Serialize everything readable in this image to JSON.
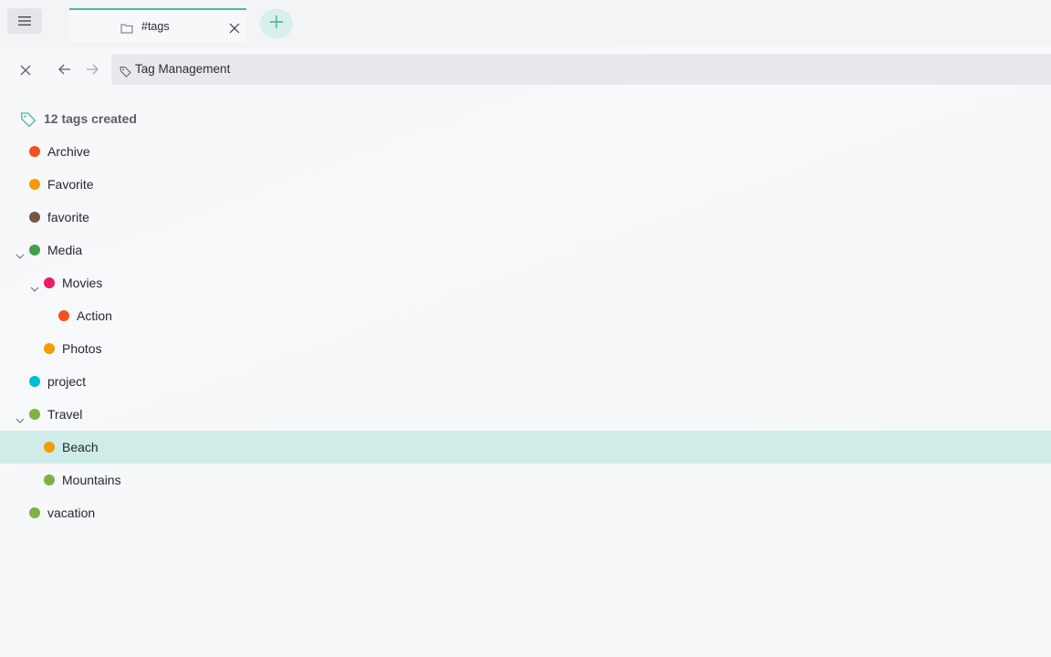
{
  "tabbar": {
    "menu_icon": "hamburger-icon",
    "tab": {
      "title": "#tags",
      "icon": "folder-icon",
      "close_icon": "close-icon",
      "accent": "#4db6a8"
    },
    "add_icon": "plus-icon"
  },
  "nav": {
    "close_icon": "close-icon",
    "back_icon": "arrow-left-icon",
    "forward_icon": "arrow-right-icon",
    "address": {
      "icon": "tag-icon",
      "text": "Tag Management"
    }
  },
  "content": {
    "summary": {
      "icon": "tag-icon",
      "text": "12 tags created",
      "icon_color": "#4db6a8"
    },
    "tags": [
      {
        "label": "Archive",
        "color": "#f4511e",
        "level": 0,
        "expandable": false
      },
      {
        "label": "Favorite",
        "color": "#f59b00",
        "level": 0,
        "expandable": false
      },
      {
        "label": "favorite",
        "color": "#795548",
        "level": 0,
        "expandable": false
      },
      {
        "label": "Media",
        "color": "#43a047",
        "level": 0,
        "expandable": true,
        "expanded": true
      },
      {
        "label": "Movies",
        "color": "#e91e63",
        "level": 1,
        "expandable": true,
        "expanded": true
      },
      {
        "label": "Action",
        "color": "#f4511e",
        "level": 2,
        "expandable": false
      },
      {
        "label": "Photos",
        "color": "#f59b00",
        "level": 1,
        "expandable": false
      },
      {
        "label": "project",
        "color": "#00bcd4",
        "level": 0,
        "expandable": false
      },
      {
        "label": "Travel",
        "color": "#7cb342",
        "level": 0,
        "expandable": true,
        "expanded": true
      },
      {
        "label": "Beach",
        "color": "#f59b00",
        "level": 1,
        "expandable": false,
        "selected": true
      },
      {
        "label": "Mountains",
        "color": "#7cb342",
        "level": 1,
        "expandable": false
      },
      {
        "label": "vacation",
        "color": "#7cb342",
        "level": 0,
        "expandable": false
      }
    ]
  },
  "colors": {
    "accent": "#4db6a8",
    "selected_row": "#cfece8"
  }
}
